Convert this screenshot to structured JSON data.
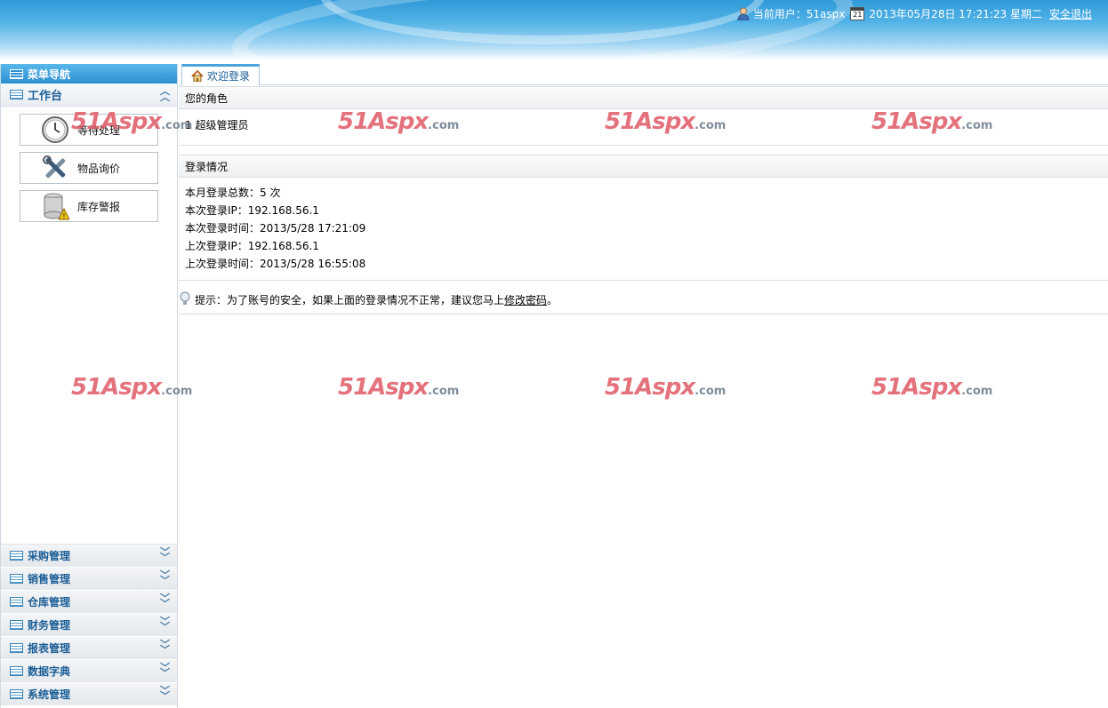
{
  "header": {
    "user_label": "当前用户：",
    "user_name": "51aspx",
    "calendar_day": "21",
    "datetime": "2013年05月28日 17:21:23 星期二",
    "logout": "安全退出"
  },
  "sidebar": {
    "title": "菜单导航",
    "workbench": {
      "title": "工作台",
      "buttons": [
        {
          "label": "等待处理",
          "icon": "clock-icon"
        },
        {
          "label": "物品询价",
          "icon": "tools-icon"
        },
        {
          "label": "库存警报",
          "icon": "database-warning-icon"
        }
      ]
    },
    "menus": [
      {
        "label": "采购管理"
      },
      {
        "label": "销售管理"
      },
      {
        "label": "仓库管理"
      },
      {
        "label": "财务管理"
      },
      {
        "label": "报表管理"
      },
      {
        "label": "数据字典"
      },
      {
        "label": "系统管理"
      }
    ]
  },
  "tab": {
    "label": "欢迎登录",
    "icon": "home-icon"
  },
  "role": {
    "title": "您的角色",
    "value": "1  超级管理员"
  },
  "login": {
    "title": "登录情况",
    "lines": [
      "本月登录总数：5 次",
      "本次登录IP：192.168.56.1",
      "本次登录时间：2013/5/28 17:21:09",
      "上次登录IP：192.168.56.1",
      "上次登录时间：2013/5/28 16:55:08"
    ]
  },
  "tip": {
    "text": "提示：为了账号的安全，如果上面的登录情况不正常，建议您马上 ",
    "link": "修改密码",
    "end": "。"
  },
  "watermark": {
    "main": "51Aspx",
    "suffix": ".com"
  },
  "colors": {
    "accent": "#2b8fd0",
    "menu_text": "#1a5d96",
    "watermark": "#e05a66"
  }
}
